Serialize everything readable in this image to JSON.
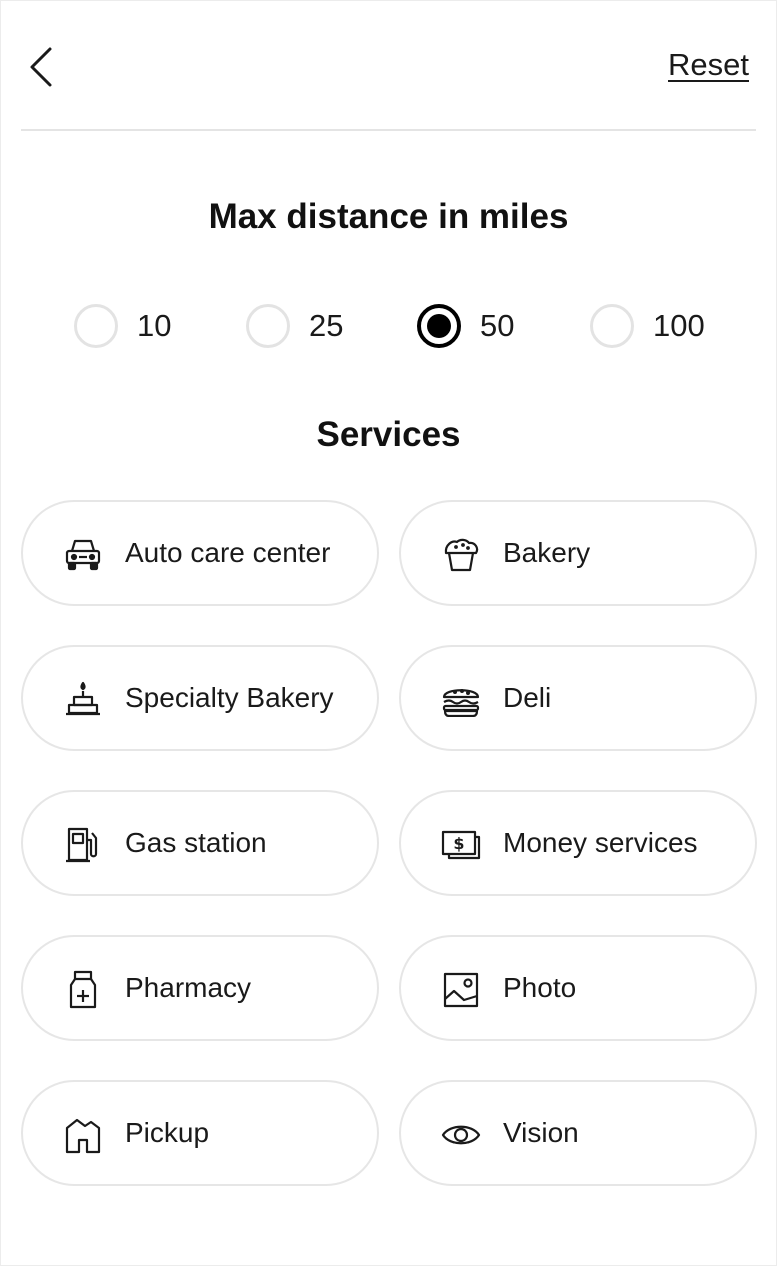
{
  "header": {
    "back_icon": "chevron-left-icon",
    "reset_label": "Reset"
  },
  "distance": {
    "title": "Max distance in miles",
    "options": [
      {
        "label": "10",
        "selected": false
      },
      {
        "label": "25",
        "selected": false
      },
      {
        "label": "50",
        "selected": true
      },
      {
        "label": "100",
        "selected": false
      }
    ]
  },
  "services": {
    "title": "Services",
    "items": [
      {
        "label": "Auto care center",
        "icon": "car-icon"
      },
      {
        "label": "Bakery",
        "icon": "muffin-icon"
      },
      {
        "label": "Specialty Bakery",
        "icon": "cake-icon"
      },
      {
        "label": "Deli",
        "icon": "burger-icon"
      },
      {
        "label": "Gas station",
        "icon": "gas-pump-icon"
      },
      {
        "label": "Money services",
        "icon": "money-icon"
      },
      {
        "label": "Pharmacy",
        "icon": "medicine-bottle-icon"
      },
      {
        "label": "Photo",
        "icon": "photo-icon"
      },
      {
        "label": "Pickup",
        "icon": "store-icon"
      },
      {
        "label": "Vision",
        "icon": "eye-icon"
      }
    ]
  },
  "colors": {
    "text": "#1a1a1a",
    "border": "#e6e6e6",
    "selected": "#000000"
  }
}
